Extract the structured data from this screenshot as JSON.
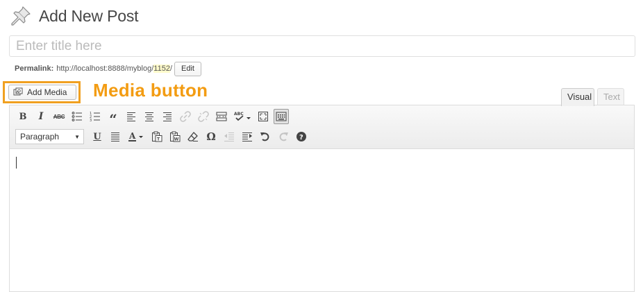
{
  "header": {
    "title": "Add New Post",
    "icon": "push-pin-icon"
  },
  "title_field": {
    "placeholder": "Enter title here",
    "value": ""
  },
  "permalink": {
    "label": "Permalink:",
    "base_url": "http://localhost:8888/myblog/",
    "slug": "1152",
    "trailing": "/",
    "edit_label": "Edit"
  },
  "media": {
    "button_label": "Add Media",
    "annotation": "Media button",
    "annotation_color": "#f39c12"
  },
  "editor_tabs": {
    "visual": "Visual",
    "text": "Text"
  },
  "toolbar": {
    "row1": [
      {
        "name": "bold",
        "glyph": "B"
      },
      {
        "name": "italic",
        "glyph": "I"
      },
      {
        "name": "strikethrough",
        "glyph": "ABC"
      },
      {
        "name": "bulleted-list"
      },
      {
        "name": "numbered-list"
      },
      {
        "name": "blockquote",
        "glyph": "“"
      },
      {
        "name": "align-left"
      },
      {
        "name": "align-center"
      },
      {
        "name": "align-right"
      },
      {
        "name": "insert-link"
      },
      {
        "name": "remove-link"
      },
      {
        "name": "read-more"
      },
      {
        "name": "spellcheck",
        "glyph": "ABC"
      },
      {
        "name": "fullscreen"
      },
      {
        "name": "kitchen-sink"
      }
    ],
    "row2": {
      "format_select": "Paragraph",
      "buttons": [
        {
          "name": "underline",
          "glyph": "U"
        },
        {
          "name": "justify"
        },
        {
          "name": "text-color",
          "glyph": "A"
        },
        {
          "name": "paste-as-text"
        },
        {
          "name": "paste-from-word"
        },
        {
          "name": "clear-formatting"
        },
        {
          "name": "special-character",
          "glyph": "Ω"
        },
        {
          "name": "outdent"
        },
        {
          "name": "indent"
        },
        {
          "name": "undo"
        },
        {
          "name": "redo"
        },
        {
          "name": "help"
        }
      ]
    }
  },
  "colors": {
    "highlight_border": "#f0a020",
    "permalink_slug_bg": "#fffbcc"
  }
}
